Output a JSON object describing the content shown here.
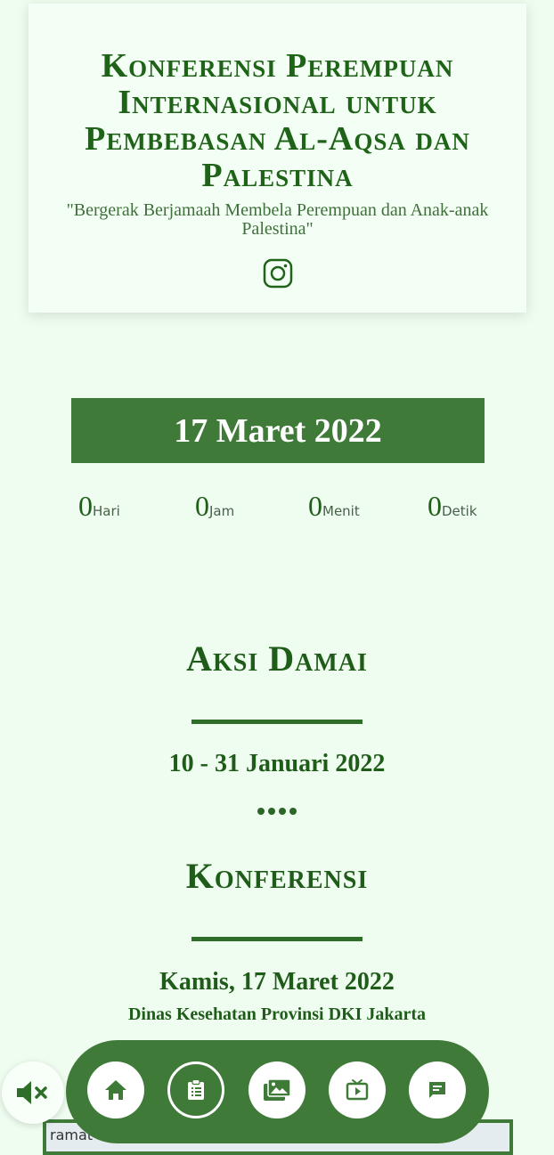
{
  "hero": {
    "title": "Konferensi Perempuan Internasional untuk Pembebasan Al-Aqsa dan Palestina",
    "tagline": "\"Bergerak Berjamaah Membela Perempuan dan Anak-anak Palestina\"",
    "social_icon": "instagram-icon"
  },
  "event_date": "17 Maret 2022",
  "countdown": [
    {
      "value": "0",
      "unit": "Hari"
    },
    {
      "value": "0",
      "unit": "Jam"
    },
    {
      "value": "0",
      "unit": "Menit"
    },
    {
      "value": "0",
      "unit": "Detik"
    }
  ],
  "sections": [
    {
      "title": "Aksi Damai",
      "date": "10 - 31 Januari 2022"
    },
    {
      "title": "Konferensi",
      "date": "Kamis, 17 Maret 2022",
      "venue": "Dinas Kesehatan Provinsi DKI Jakarta"
    }
  ],
  "map": {
    "partial_text": "ramat"
  },
  "audio": {
    "icon": "volume-mute-icon"
  },
  "nav": [
    {
      "icon": "home-icon",
      "active": false
    },
    {
      "icon": "clipboard-icon",
      "active": true
    },
    {
      "icon": "gallery-icon",
      "active": false
    },
    {
      "icon": "video-icon",
      "active": false
    },
    {
      "icon": "message-icon",
      "active": false
    }
  ],
  "colors": {
    "background": "#effdf0",
    "primary": "#3f7a39",
    "text": "#1f5c19"
  }
}
